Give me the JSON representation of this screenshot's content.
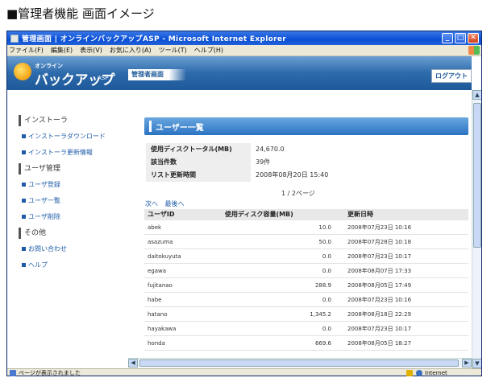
{
  "caption": "■管理者機能 画面イメージ",
  "window": {
    "title": "管理画面 | オンラインバックアップASP - Microsoft Internet Explorer",
    "minimize": "_",
    "maximize": "□",
    "close": "✕"
  },
  "menubar": {
    "items": [
      "ファイル(F)",
      "編集(E)",
      "表示(V)",
      "お気に入り(A)",
      "ツール(T)",
      "ヘルプ(H)"
    ]
  },
  "header": {
    "logo_small": "オンライン",
    "logo_main": "バックアップ",
    "logo_suffix": "ASP",
    "admin_tab": "管理者画面",
    "logout": "ログアウト"
  },
  "sidebar": {
    "sections": [
      {
        "heading": "インストーラ",
        "links": [
          "インストーラダウンロード",
          "インストーラ更新情報"
        ]
      },
      {
        "heading": "ユーザ管理",
        "links": [
          "ユーザ登録",
          "ユーザ一覧",
          "ユーザ削除"
        ]
      },
      {
        "heading": "その他",
        "links": [
          "お問い合わせ",
          "ヘルプ"
        ]
      }
    ]
  },
  "main": {
    "title": "ユーザー一覧",
    "summary": [
      {
        "label": "使用ディスクトータル(MB)",
        "value": "24,670.0"
      },
      {
        "label": "該当件数",
        "value": "39件"
      },
      {
        "label": "リスト更新時間",
        "value": "2008年08月20日 15:40"
      }
    ],
    "page_info": "1 / 2ページ",
    "pager": {
      "next": "次へ",
      "last": "最後へ"
    },
    "table": {
      "headers": [
        "ユーザID",
        "使用ディスク容量(MB)",
        "更新日時"
      ],
      "rows": [
        [
          "abek",
          "10.0",
          "2008年07月23日 10:16"
        ],
        [
          "asazuma",
          "50.0",
          "2008年07月28日 10:18"
        ],
        [
          "daitokuyuta",
          "0.0",
          "2008年07月23日 10:17"
        ],
        [
          "egawa",
          "0.0",
          "2008年08月07日 17:33"
        ],
        [
          "fujitanao",
          "288.9",
          "2008年08月05日 17:49"
        ],
        [
          "habe",
          "0.0",
          "2008年07月23日 10:16"
        ],
        [
          "hatano",
          "1,345.2",
          "2008年08月18日 22:29"
        ],
        [
          "hayakawa",
          "0.0",
          "2008年07月23日 10:17"
        ],
        [
          "honda",
          "669.6",
          "2008年08月05日 18:27"
        ]
      ]
    }
  },
  "statusbar": {
    "text": "ページが表示されました",
    "zone": "Internet"
  }
}
